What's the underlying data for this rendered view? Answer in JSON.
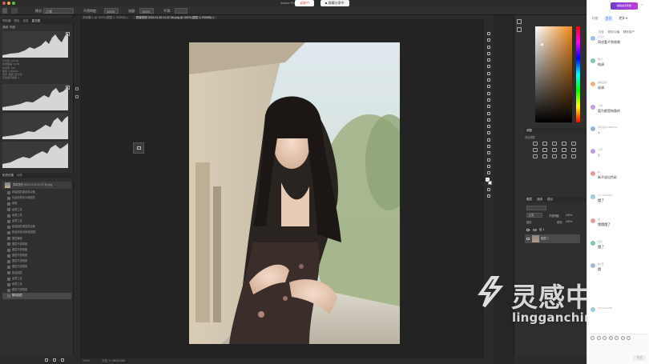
{
  "mac_bar": {
    "title": "Adobe Photoshop",
    "rec_label": "录屏中",
    "share_label": "■ 屏幕分享中"
  },
  "options_bar": {
    "mode_label": "模式:",
    "mode_value": "正常",
    "opacity_label": "不透明度:",
    "opacity_value": "100%",
    "flow_label": "流量:",
    "flow_value": "100%",
    "smooth_label": "平滑:"
  },
  "doc_tabs": [
    "未标题-1 @ 100% (图层 1, RGB/8) ×",
    "屏幕快照 2019-11-30 21.37.36.png @ 100% (图层 1, RGB/8) ×"
  ],
  "left_panel": {
    "tabs": [
      "导航器",
      "颜色",
      "信息",
      "直方图"
    ],
    "histogram_source": "通道: 明度",
    "stats": [
      [
        "平均值:",
        "163.98"
      ],
      [
        "标准偏差:",
        "63.99"
      ],
      [
        "中间值:",
        "169"
      ],
      [
        "像素:",
        "1481300"
      ],
      [
        "色阶:",
        ""
      ],
      [
        "数量:",
        ""
      ],
      [
        "百分位:",
        ""
      ],
      [
        "高速缓存级别:",
        "3"
      ]
    ],
    "history_tabs": [
      "历史记录",
      "动作"
    ],
    "snapshot_label": "屏幕快照 2019-11-30 21.37.36.png",
    "history": [
      "新建图层通道混合器",
      "将曲线修改为新图层",
      "画笔",
      "画笔工具",
      "画笔工具",
      "画笔工具",
      "新建图层通道混合器",
      "新建色相/饱和度图层",
      "图层编组",
      "图层不透明度",
      "图层不透明度",
      "图层不透明度",
      "图层不透明度",
      "图层不透明度",
      "新建图层",
      "画笔工具",
      "画笔工具",
      "图层不透明度",
      "删除图层"
    ]
  },
  "status": {
    "zoom": "100%",
    "doc": "文档: 6.28M/6.28M"
  },
  "right_panel": {
    "adjust_tab": "调整",
    "adjust_label": "添加调整",
    "layers_tabs": [
      "图层",
      "通道",
      "路径"
    ],
    "blend": "正常",
    "opacity_label": "不透明度:",
    "opacity_value": "100%",
    "lock_label": "锁定:",
    "fill_label": "填充:",
    "fill_value": "100%",
    "layers": [
      "组 1",
      "图层 1"
    ]
  },
  "chat": {
    "promo": "超级会员专属",
    "tabs": [
      "讨论",
      "会员",
      "更多 ▾"
    ],
    "subtabs": [
      "讨论",
      "精彩点播",
      "精彩用户"
    ],
    "messages": [
      {
        "name": "广州8",
        "text": "再也看不到效果",
        "color": "#9cc4f0"
      },
      {
        "name": "路过",
        "text": "纯调",
        "color": "#7fc9a8"
      },
      {
        "name": "捕风追影",
        "text": "说调",
        "color": "#f2b27a"
      },
      {
        "name": "小师",
        "text": "面为都是纯属的",
        "color": "#c39ce8"
      },
      {
        "name": "手机用户18889xxx",
        "text": "1",
        "color": "#8fb3e0"
      },
      {
        "name": "小师",
        "text": "1",
        "color": "#c39ce8"
      },
      {
        "name": "林",
        "text": "新不退出色彩",
        "color": "#e89a9a"
      },
      {
        "name": "Unyweteet88",
        "text": "懂了",
        "color": "#9cc9e8"
      },
      {
        "name": "林",
        "text": "懂懂懂了",
        "color": "#e89a9a"
      },
      {
        "name": "路过",
        "text": "懂了",
        "color": "#7fc9a8"
      },
      {
        "name": "新2号",
        "text": "懂",
        "color": "#a4b8d6"
      },
      {
        "name": "Unyweteet88",
        "text": "",
        "color": "#9cc9e8"
      }
    ],
    "send_label": "发送"
  },
  "watermark": {
    "cn": "灵感中国",
    "url": "lingganchina.com"
  }
}
